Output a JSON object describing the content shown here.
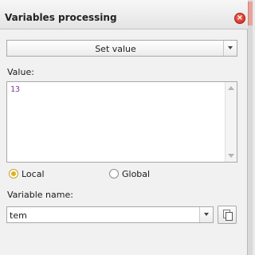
{
  "window": {
    "title": "Variables processing",
    "close_glyph": "×"
  },
  "operation": {
    "selected": "Set value"
  },
  "value": {
    "label": "Value:",
    "content": "13"
  },
  "scope": {
    "options": [
      {
        "label": "Local",
        "checked": true
      },
      {
        "label": "Global",
        "checked": false
      }
    ]
  },
  "variable": {
    "label": "Variable name:",
    "value": "tem"
  },
  "colors": {
    "close": "#d9342a",
    "radio_selected": "#e0b020",
    "value_text": "#7a3e9d"
  },
  "icons": {
    "close": "close-icon",
    "dropdown": "chevron-down-icon",
    "copy": "copy-icon"
  }
}
